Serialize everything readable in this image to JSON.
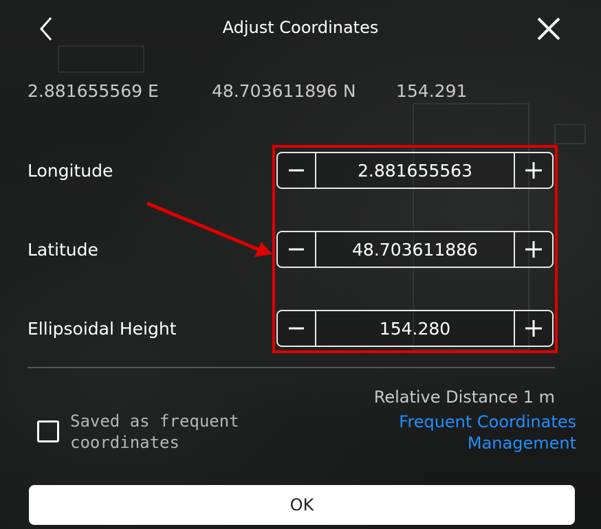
{
  "header": {
    "title": "Adjust Coordinates",
    "back_icon": "chevron-left-icon",
    "close_icon": "close-icon"
  },
  "current": {
    "longitude": "2.881655569 E",
    "latitude": "48.703611896 N",
    "height": "154.291"
  },
  "rows": [
    {
      "label": "Longitude",
      "value": "2.881655563"
    },
    {
      "label": "Latitude",
      "value": "48.703611886"
    },
    {
      "label": "Ellipsoidal Height",
      "value": "154.280"
    }
  ],
  "stepper_icons": {
    "minus": "minus-icon",
    "plus": "plus-icon"
  },
  "save": {
    "label": "Saved as frequent coordinates",
    "checked": false
  },
  "relative_distance": "Relative Distance 1 m",
  "frequent_link": "Frequent Coordinates Management",
  "ok_label": "OK",
  "colors": {
    "highlight": "#e00000",
    "link": "#1e90ff",
    "background": "#1a1b1b"
  }
}
